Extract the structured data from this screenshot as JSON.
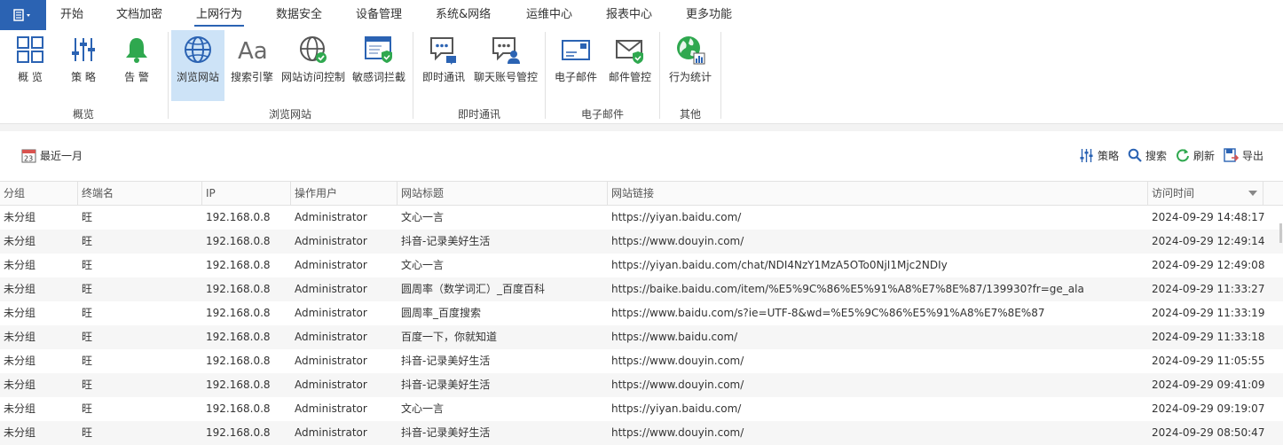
{
  "menu": {
    "tabs": [
      "开始",
      "文档加密",
      "上网行为",
      "数据安全",
      "设备管理",
      "系统&网络",
      "运维中心",
      "报表中心",
      "更多功能"
    ],
    "active_tab": "上网行为"
  },
  "ribbon": {
    "buttons": {
      "overview": "概 览",
      "policy": "策 略",
      "alarm": "告 警",
      "browse": "浏览网站",
      "search": "搜索引擎",
      "siteaccess": "网站访问控制",
      "sensitive": "敏感词拦截",
      "im": "即时通讯",
      "chatacct": "聊天账号管控",
      "email": "电子邮件",
      "emailctl": "邮件管控",
      "stats": "行为统计"
    },
    "groups": {
      "overview": "概览",
      "browse": "浏览网站",
      "im": "即时通讯",
      "email": "电子邮件",
      "other": "其他"
    }
  },
  "toolbar": {
    "date_range": "最近一月",
    "date_icon_day": "23",
    "policy": "策略",
    "search": "搜索",
    "refresh": "刷新",
    "export": "导出"
  },
  "table": {
    "headers": {
      "group": "分组",
      "terminal": "终端名",
      "ip": "IP",
      "user": "操作用户",
      "title": "网站标题",
      "url": "网站链接",
      "time": "访问时间"
    },
    "rows": [
      {
        "group": "未分组",
        "terminal": "旺",
        "ip": "192.168.0.8",
        "user": "Administrator",
        "title": "文心一言",
        "url": "https://yiyan.baidu.com/",
        "time": "2024-09-29 14:48:17"
      },
      {
        "group": "未分组",
        "terminal": "旺",
        "ip": "192.168.0.8",
        "user": "Administrator",
        "title": "抖音-记录美好生活",
        "url": "https://www.douyin.com/",
        "time": "2024-09-29 12:49:14"
      },
      {
        "group": "未分组",
        "terminal": "旺",
        "ip": "192.168.0.8",
        "user": "Administrator",
        "title": "文心一言",
        "url": "https://yiyan.baidu.com/chat/NDI4NzY1MzA5OTo0NjI1Mjc2NDIy",
        "time": "2024-09-29 12:49:08"
      },
      {
        "group": "未分组",
        "terminal": "旺",
        "ip": "192.168.0.8",
        "user": "Administrator",
        "title": "圆周率（数学词汇）_百度百科",
        "url": "https://baike.baidu.com/item/%E5%9C%86%E5%91%A8%E7%8E%87/139930?fr=ge_ala",
        "time": "2024-09-29 11:33:27"
      },
      {
        "group": "未分组",
        "terminal": "旺",
        "ip": "192.168.0.8",
        "user": "Administrator",
        "title": "圆周率_百度搜索",
        "url": "https://www.baidu.com/s?ie=UTF-8&wd=%E5%9C%86%E5%91%A8%E7%8E%87",
        "time": "2024-09-29 11:33:19"
      },
      {
        "group": "未分组",
        "terminal": "旺",
        "ip": "192.168.0.8",
        "user": "Administrator",
        "title": "百度一下，你就知道",
        "url": "https://www.baidu.com/",
        "time": "2024-09-29 11:33:18"
      },
      {
        "group": "未分组",
        "terminal": "旺",
        "ip": "192.168.0.8",
        "user": "Administrator",
        "title": "抖音-记录美好生活",
        "url": "https://www.douyin.com/",
        "time": "2024-09-29 11:05:55"
      },
      {
        "group": "未分组",
        "terminal": "旺",
        "ip": "192.168.0.8",
        "user": "Administrator",
        "title": "抖音-记录美好生活",
        "url": "https://www.douyin.com/",
        "time": "2024-09-29 09:41:09"
      },
      {
        "group": "未分组",
        "terminal": "旺",
        "ip": "192.168.0.8",
        "user": "Administrator",
        "title": "文心一言",
        "url": "https://yiyan.baidu.com/",
        "time": "2024-09-29 09:19:07"
      },
      {
        "group": "未分组",
        "terminal": "旺",
        "ip": "192.168.0.8",
        "user": "Administrator",
        "title": "抖音-记录美好生活",
        "url": "https://www.douyin.com/",
        "time": "2024-09-29 08:50:47"
      }
    ]
  },
  "colors": {
    "accent": "#2b63b3",
    "selected_button": "#cde3f7",
    "alarm_green": "#2fa84f",
    "refresh_green": "#2fa84f"
  }
}
